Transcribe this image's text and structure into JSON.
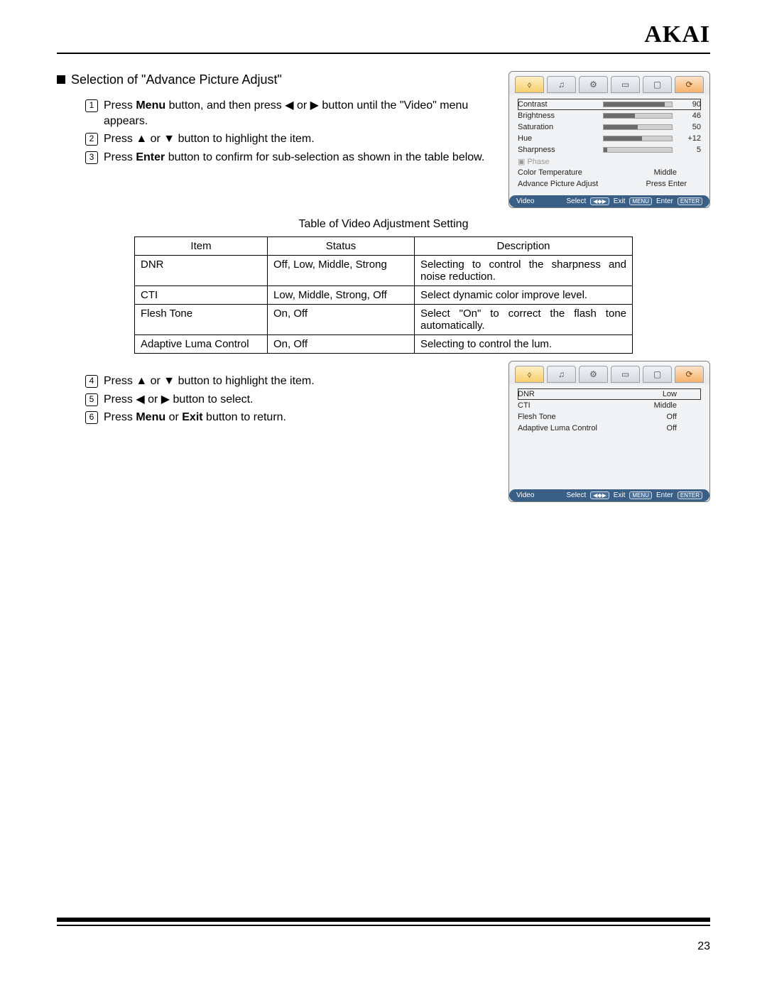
{
  "brand": "AKAI",
  "page_number": "23",
  "section_title": "Selection of \"Advance Picture Adjust\"",
  "steps_top": [
    {
      "num": "1",
      "pre": "Press ",
      "strong": "Menu",
      "post": " button, and then press ◀ or ▶ button until the \"Video\" menu appears."
    },
    {
      "num": "2",
      "pre": "Press ▲ or ▼ button to highlight the item.",
      "strong": "",
      "post": ""
    },
    {
      "num": "3",
      "pre": "Press ",
      "strong": "Enter",
      "post": " button to confirm for sub-selection as shown in the table below."
    }
  ],
  "table_caption": "Table of Video Adjustment Setting",
  "table_headers": {
    "item": "Item",
    "status": "Status",
    "desc": "Description"
  },
  "table_rows": [
    {
      "item": "DNR",
      "status": "Off, Low, Middle, Strong",
      "desc": "Selecting to control the sharpness and noise reduction."
    },
    {
      "item": "CTI",
      "status": "Low, Middle, Strong, Off",
      "desc": "Select dynamic color improve level."
    },
    {
      "item": "Flesh Tone",
      "status": "On, Off",
      "desc": "Select \"On\" to correct the flash tone automatically."
    },
    {
      "item": "Adaptive Luma Control",
      "status": "On, Off",
      "desc": "Selecting to control the lum."
    }
  ],
  "steps_bottom": [
    {
      "num": "4",
      "pre": "Press ▲ or ▼ button to highlight the item.",
      "strong": "",
      "post": ""
    },
    {
      "num": "5",
      "pre": "Press ◀ or ▶ button to select.",
      "strong": "",
      "post": ""
    },
    {
      "num": "6",
      "pre": "Press ",
      "strong": "Menu",
      "mid": " or ",
      "strong2": "Exit",
      "post": " button to return."
    }
  ],
  "osd1": {
    "tabs_glyphs": [
      "⬨",
      "♫",
      "⚙",
      "▭",
      "▢",
      "⟳"
    ],
    "rows_slider": [
      {
        "label": "Contrast",
        "value": "90",
        "pct": 90,
        "highlight": true
      },
      {
        "label": "Brightness",
        "value": "46",
        "pct": 46
      },
      {
        "label": "Saturation",
        "value": "50",
        "pct": 50
      },
      {
        "label": "Hue",
        "value": "+12",
        "pct": 56
      },
      {
        "label": "Sharpness",
        "value": "5",
        "pct": 5
      }
    ],
    "disabled_row": "▣ Phase",
    "text_rows": [
      {
        "label": "Color Temperature",
        "value": "Middle"
      },
      {
        "label": "Advance Picture Adjust",
        "value": "Press Enter"
      }
    ],
    "footer": {
      "title": "Video",
      "select": "Select",
      "select_icon": "◀◆▶",
      "exit": "Exit",
      "exit_badge": "MENU",
      "enter": "Enter",
      "enter_badge": "ENTER"
    }
  },
  "osd2": {
    "rows": [
      {
        "label": "DNR",
        "value": "Low",
        "highlight": true
      },
      {
        "label": "CTI",
        "value": "Middle"
      },
      {
        "label": "Flesh Tone",
        "value": "Off"
      },
      {
        "label": "Adaptive Luma Control",
        "value": "Off"
      }
    ],
    "footer": {
      "title": "Video",
      "select": "Select",
      "select_icon": "◀◆▶",
      "exit": "Exit",
      "exit_badge": "MENU",
      "enter": "Enter",
      "enter_badge": "ENTER"
    }
  }
}
